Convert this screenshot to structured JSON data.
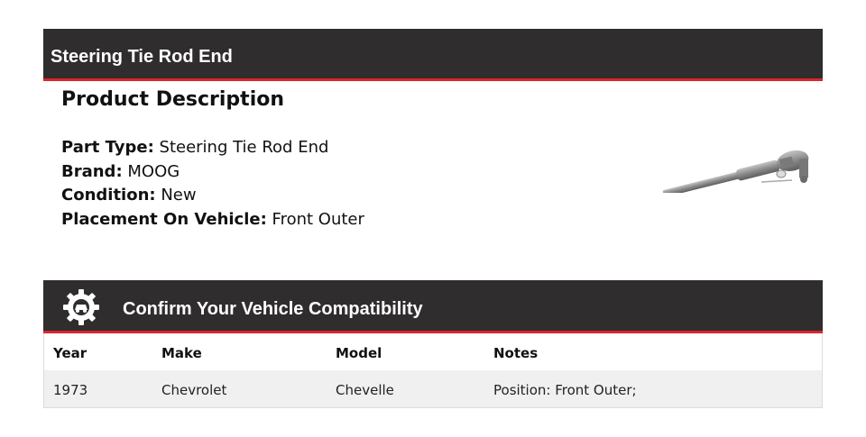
{
  "header": {
    "title": "Steering Tie Rod End"
  },
  "description": {
    "heading": "Product Description",
    "specs": [
      {
        "label": "Part Type:",
        "value": "Steering Tie Rod End"
      },
      {
        "label": "Brand:",
        "value": "MOOG"
      },
      {
        "label": "Condition:",
        "value": "New"
      },
      {
        "label": "Placement On Vehicle:",
        "value": "Front Outer"
      }
    ]
  },
  "compatibility": {
    "title": "Confirm Your Vehicle Compatibility",
    "icon": "gear-car-icon",
    "columns": [
      "Year",
      "Make",
      "Model",
      "Notes"
    ],
    "rows": [
      [
        "1973",
        "Chevrolet",
        "Chevelle",
        "Position: Front Outer;"
      ]
    ]
  },
  "colors": {
    "bar": "#2f2d2e",
    "accent": "#d8262e",
    "row_alt": "#f0f0f0"
  }
}
